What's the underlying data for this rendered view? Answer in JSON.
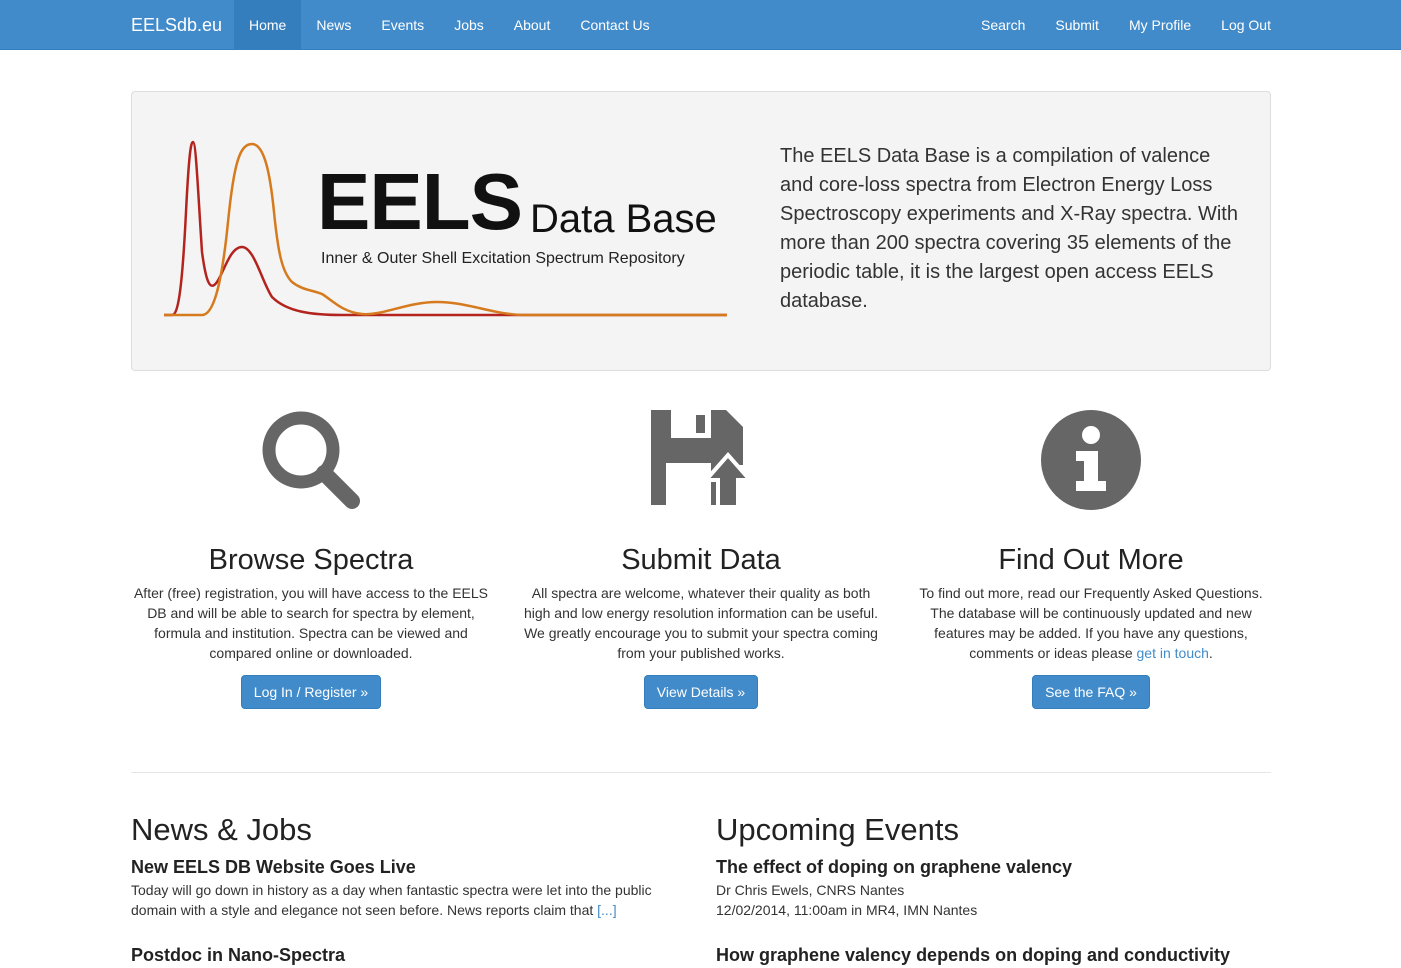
{
  "nav": {
    "brand": "EELSdb.eu",
    "left": [
      "Home",
      "News",
      "Events",
      "Jobs",
      "About",
      "Contact Us"
    ],
    "right": [
      "Search",
      "Submit",
      "My Profile",
      "Log Out"
    ]
  },
  "jumbotron": {
    "logo_title": "EELS",
    "logo_subtitle": "Data Base",
    "logo_tagline": "Inner & Outer Shell Excitation Spectrum Repository",
    "description": "The EELS Data Base is a compilation of valence and core-loss spectra from Electron Energy Loss Spectroscopy experiments and X-Ray spectra. With more than 200 spectra covering 35 elements of the periodic table, it is the largest open access EELS database."
  },
  "features": [
    {
      "icon": "search-icon",
      "title": "Browse Spectra",
      "text": "After (free) registration, you will have access to the EELS DB and will be able to search for spectra by element, formula and institution. Spectra can be viewed and compared online or downloaded.",
      "button": "Log In / Register »"
    },
    {
      "icon": "save-upload-icon",
      "title": "Submit Data",
      "text": "All spectra are welcome, whatever their quality as both high and low energy resolution information can be useful. We greatly encourage you to submit your spectra coming from your published works.",
      "button": "View Details »"
    },
    {
      "icon": "info-icon",
      "title": "Find Out More",
      "text_before": "To find out more, read our Frequently Asked Questions. The database will be continuously updated and new features may be added. If you have any questions, comments or ideas please ",
      "link": "get in touch",
      "text_after": ".",
      "button": "See the FAQ »"
    }
  ],
  "news": {
    "heading": "News & Jobs",
    "items": [
      {
        "title": "New EELS DB Website Goes Live",
        "text": "Today will go down in history as a day when fantastic spectra were let into the public domain with a style and elegance not seen before. News reports claim that ",
        "more": "[...]"
      },
      {
        "title": "Postdoc in Nano-Spectra"
      }
    ]
  },
  "events": {
    "heading": "Upcoming Events",
    "items": [
      {
        "title": "The effect of doping on graphene valency",
        "speaker": "Dr Chris Ewels, CNRS Nantes",
        "when": "12/02/2014, 11:00am in MR4, IMN Nantes"
      },
      {
        "title": "How graphene valency depends on doping and conductivity"
      }
    ]
  },
  "colors": {
    "primary": "#428bca",
    "curve_red": "#b3241f",
    "curve_orange": "#d67a1e",
    "icon_gray": "#666666"
  }
}
